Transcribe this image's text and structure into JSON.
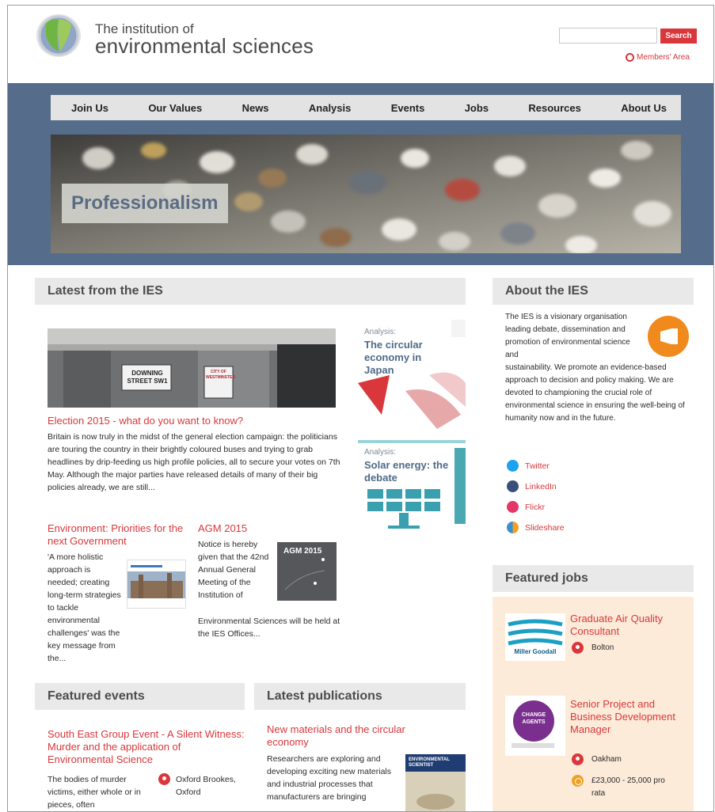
{
  "header": {
    "logo_line1": "The institution of",
    "logo_line2": "environmental sciences",
    "search_placeholder": "",
    "search_button": "Search",
    "members_area": "Members' Area"
  },
  "nav": {
    "items": [
      {
        "label": "Join Us"
      },
      {
        "label": "Our Values"
      },
      {
        "label": "News"
      },
      {
        "label": "Analysis"
      },
      {
        "label": "Events"
      },
      {
        "label": "Jobs"
      },
      {
        "label": "Resources"
      },
      {
        "label": "About Us"
      }
    ]
  },
  "hero": {
    "label": "Professionalism"
  },
  "latest": {
    "heading": "Latest from the IES",
    "main_story": {
      "image_sign_1": "DOWNING STREET SW1",
      "image_sign_2": "CITY OF WESTMINSTER",
      "title": "Election 2015 - what do you want to know?",
      "text": "Britain is now truly in the midst of the general election campaign: the politicians are touring the country in their brightly coloured buses and trying to grab headlines by drip-feeding us high profile policies, all to secure your votes on 7th May. Although the major parties have released details of many of their big policies already, we are still..."
    },
    "env_story": {
      "title": "Environment: Priorities for the next Government",
      "text": "'A more holistic approach is needed; creating long-term strategies to tackle environmental challenges' was the key message from the..."
    },
    "agm_story": {
      "title": "AGM 2015",
      "text_narrow": "Notice is hereby given that the 42nd Annual General Meeting of the Institution of",
      "text_wide": "Environmental Sciences will be held at the IES Offices...",
      "thumb_label": "AGM 2015"
    }
  },
  "analysis": [
    {
      "kicker": "Analysis:",
      "title": "The circular economy in Japan"
    },
    {
      "kicker": "Analysis:",
      "title": "Solar energy: the debate"
    }
  ],
  "about": {
    "heading": "About the IES",
    "text_narrow": "The IES is a visionary organisation leading debate, dissemination and promotion of environmental science and",
    "text_wide": "sustainability. We promote an evidence-based approach to decision and policy making. We are devoted to championing the crucial role of environmental science in ensuring the well-being of humanity now and in the future.",
    "social": [
      {
        "label": "Twitter",
        "icon": "twitter-icon",
        "color": "#1da1f2"
      },
      {
        "label": "LinkedIn",
        "icon": "linkedin-icon",
        "color": "#3a4f7a"
      },
      {
        "label": "Flickr",
        "icon": "flickr-icon",
        "color": "#e5366a"
      },
      {
        "label": "Slideshare",
        "icon": "slideshare-icon",
        "color": "#f0a020"
      }
    ]
  },
  "jobs": {
    "heading": "Featured jobs",
    "items": [
      {
        "title": "Graduate Air Quality Consultant",
        "location": "Bolton",
        "logo_text": "Miller Goodall",
        "salary": ""
      },
      {
        "title": "Senior Project and Business Development Manager",
        "location": "Oakham",
        "salary": "£23,000 - 25,000 pro rata",
        "logo_text": "CHANGE AGENTS"
      }
    ]
  },
  "events": {
    "heading": "Featured events",
    "item": {
      "title": "South East Group Event - A Silent Witness: Murder and the application of Environmental Science",
      "text": "The bodies of murder victims, either whole or in pieces, often",
      "location": "Oxford Brookes, Oxford"
    }
  },
  "publications": {
    "heading": "Latest publications",
    "item": {
      "title": "New materials and the circular economy",
      "text": "Researchers are exploring and developing exciting new materials and industrial processes that manufacturers are bringing",
      "cover_label": "ENVIRONMENTAL SCIENTIST"
    }
  },
  "colors": {
    "accent_red": "#d9373b",
    "band_blue": "#566c8b",
    "jobs_bg": "#fdebd9",
    "orange": "#f08a1c"
  }
}
